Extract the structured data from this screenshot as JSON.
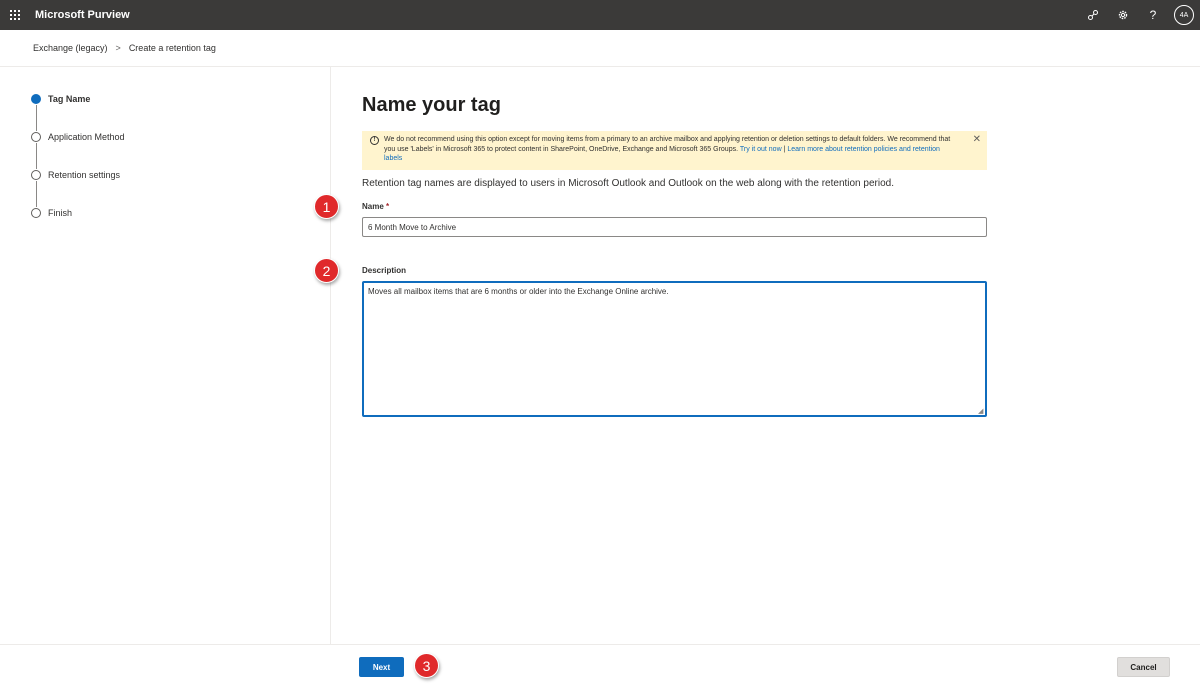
{
  "app": {
    "title": "Microsoft Purview"
  },
  "topbar": {
    "icons": [
      "connections-icon",
      "settings-icon",
      "help-icon"
    ],
    "help_glyph": "?",
    "avatar_initials": "4A"
  },
  "breadcrumb": {
    "items": [
      "Exchange (legacy)",
      "Create a retention tag"
    ],
    "separator": ">"
  },
  "steps": [
    {
      "label": "Tag Name",
      "active": true
    },
    {
      "label": "Application Method",
      "active": false
    },
    {
      "label": "Retention settings",
      "active": false
    },
    {
      "label": "Finish",
      "active": false
    }
  ],
  "main": {
    "title": "Name your tag",
    "warning": {
      "text": "We do not recommend using this option except for moving items from a primary to an archive mailbox and applying retention or deletion settings to default folders. We recommend that you use 'Labels' in Microsoft 365 to protect content in SharePoint, OneDrive, Exchange and Microsoft 365 Groups.",
      "link1": "Try it out now",
      "divider": "|",
      "link2": "Learn more about retention policies and retention labels"
    },
    "intro": "Retention tag names are displayed to users in Microsoft Outlook and Outlook on the web along with the retention period.",
    "name_label": "Name",
    "required_mark": "*",
    "name_value": "6 Month Move to Archive",
    "description_label": "Description",
    "description_value": "Moves all mailbox items that are 6 months or older into the Exchange Online archive."
  },
  "callouts": [
    "1",
    "2",
    "3"
  ],
  "footer": {
    "next_label": "Next",
    "cancel_label": "Cancel"
  },
  "colors": {
    "topbar": "#3b3a39",
    "accent": "#0f6cbd",
    "warning_bg": "#fff4ce",
    "callout": "#e0292b"
  }
}
